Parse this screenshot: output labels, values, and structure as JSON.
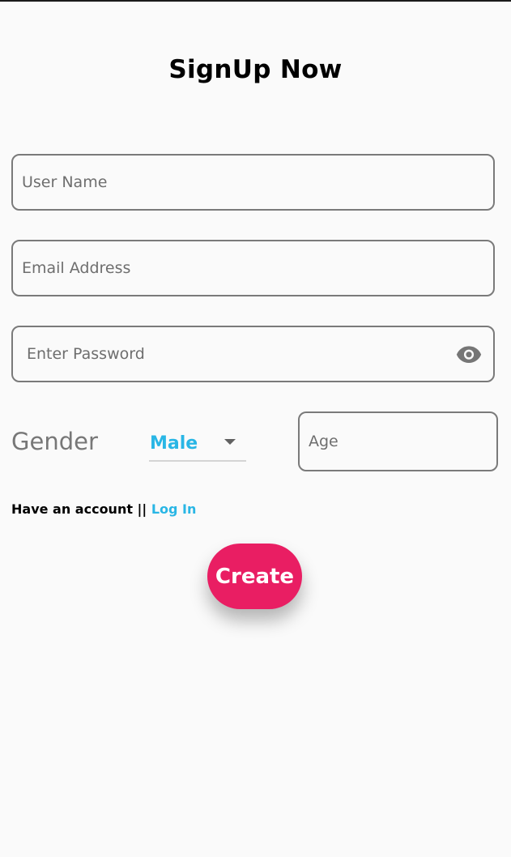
{
  "header": {
    "title": "SignUp Now"
  },
  "form": {
    "username": {
      "placeholder": "User Name",
      "value": ""
    },
    "email": {
      "placeholder": "Email Address",
      "value": ""
    },
    "password": {
      "placeholder": "Enter Password",
      "value": "",
      "toggle_icon": "eye-icon"
    },
    "gender": {
      "label": "Gender",
      "selected": "Male",
      "dropdown_icon": "caret-down-icon"
    },
    "age": {
      "placeholder": "Age",
      "value": ""
    }
  },
  "account": {
    "prompt": "Have an account || ",
    "login_label": "Log In"
  },
  "actions": {
    "create_label": "Create"
  },
  "colors": {
    "background": "#fafafa",
    "accent": "#29b6e5",
    "primary_button": "#e91e63",
    "border": "#7a7a7a",
    "muted_text": "#777777"
  }
}
